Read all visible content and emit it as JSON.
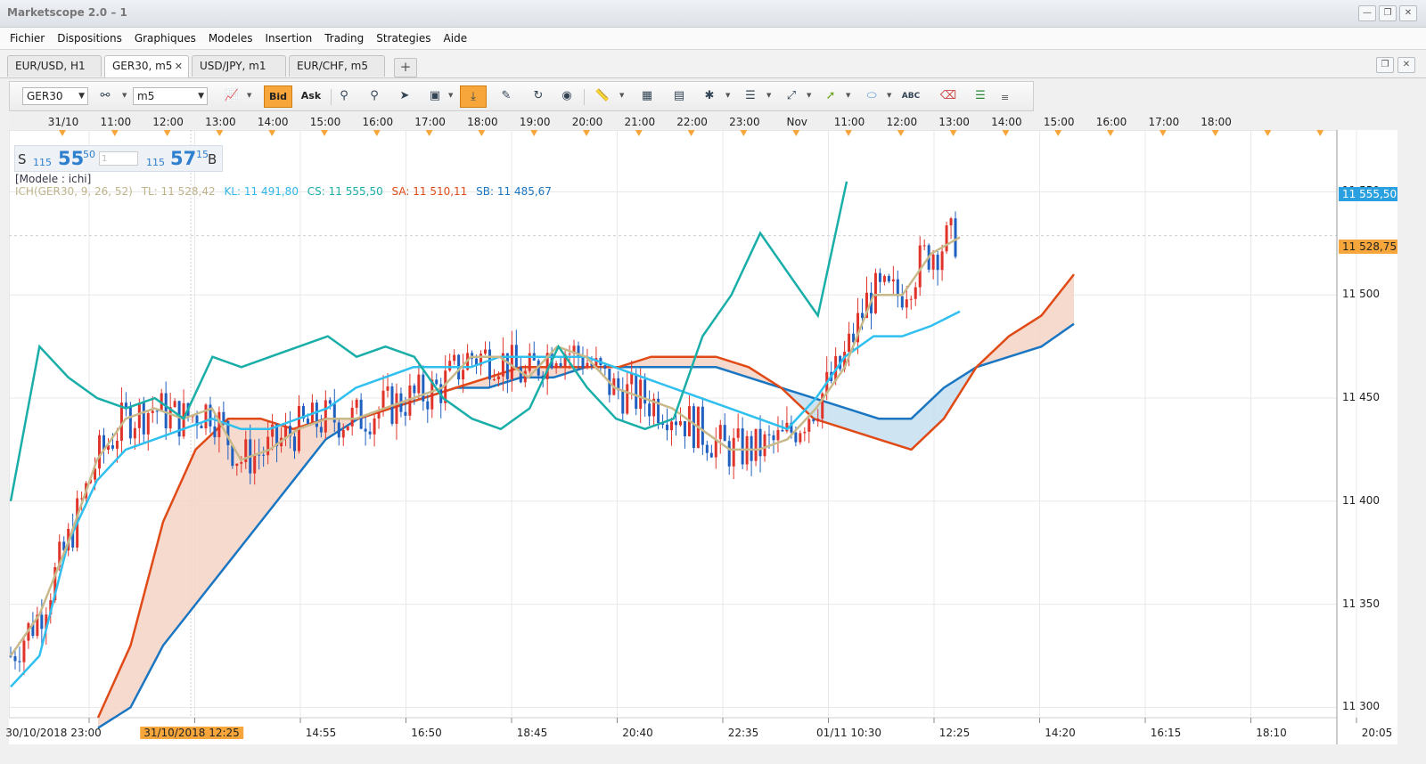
{
  "window": {
    "title": "Marketscope 2.0 – 1"
  },
  "menu": [
    "Fichier",
    "Dispositions",
    "Graphiques",
    "Modeles",
    "Insertion",
    "Trading",
    "Strategies",
    "Aide"
  ],
  "tabs": [
    {
      "label": "EUR/USD, H1"
    },
    {
      "label": "GER30, m5",
      "close": "✕"
    },
    {
      "label": "USD/JPY, m1"
    },
    {
      "label": "EUR/CHF, m5"
    }
  ],
  "toolbar": {
    "instrument": "GER30",
    "timeframe": "m5",
    "bid_label": "Bid",
    "ask_label": "Ask"
  },
  "top_time_labels": [
    "31/10",
    "11:00",
    "12:00",
    "13:00",
    "14:00",
    "15:00",
    "16:00",
    "17:00",
    "18:00",
    "19:00",
    "20:00",
    "21:00",
    "22:00",
    "23:00",
    "Nov",
    "11:00",
    "12:00",
    "13:00",
    "14:00",
    "15:00",
    "16:00",
    "17:00",
    "18:00"
  ],
  "bottom_time_labels": [
    "30/10/2018 23:00",
    "31/10/2018 12:25",
    "14:55",
    "16:50",
    "18:45",
    "20:40",
    "22:35",
    "01/11 10:30",
    "12:25",
    "14:20",
    "16:15",
    "18:10",
    "20:05"
  ],
  "price_axis": [
    "11 550",
    "11 500",
    "11 450",
    "11 400",
    "11 350",
    "11 300"
  ],
  "price_tags": {
    "cs": "11 555,50",
    "tl": "11 528,75"
  },
  "quote": {
    "sell_label": "S",
    "sell_prefix": "115",
    "sell_big": "55",
    "sell_sup": "50",
    "amount": "1",
    "buy_prefix": "115",
    "buy_big": "57",
    "buy_sup": "15",
    "buy_label": "B"
  },
  "model_label": "[Modele : ichi]",
  "indicator": {
    "name": "ICH(GER30, 9, 26, 52)",
    "tl": "TL: 11 528,42",
    "kl": "KL: 11 491,80",
    "cs": "CS: 11 555,50",
    "sa": "SA: 11 510,11",
    "sb": "SB: 11 485,67"
  },
  "colors": {
    "up": "#e0342a",
    "down": "#1f5fbf",
    "tenkan": "#c8b98a",
    "kijun": "#2fc0ef",
    "chikou": "#1aaea8",
    "senkou_a": "#e04a17",
    "senkou_b": "#1b76c2",
    "cloud_bull": "#c5dff0",
    "cloud_bear": "#f6d3c6",
    "accent": "#f7a63c"
  },
  "chart_data": {
    "type": "line",
    "title": "",
    "instrument": "GER30",
    "timeframe": "m5",
    "ylim": [
      11295,
      11580
    ],
    "y_ticks": [
      11300,
      11350,
      11400,
      11450,
      11500,
      11550
    ],
    "series": [
      {
        "name": "TL",
        "values": [
          11325,
          11345,
          11380,
          11420,
          11440,
          11445,
          11440,
          11445,
          11420,
          11425,
          11435,
          11440,
          11440,
          11445,
          11450,
          11455,
          11470,
          11470,
          11460,
          11475,
          11470,
          11455,
          11450,
          11445,
          11435,
          11425,
          11425,
          11430,
          11445,
          11465,
          11500,
          11500,
          11520,
          11528
        ]
      },
      {
        "name": "KL",
        "values": [
          11310,
          11325,
          11380,
          11410,
          11425,
          11430,
          11435,
          11440,
          11435,
          11435,
          11440,
          11445,
          11455,
          11460,
          11465,
          11465,
          11465,
          11470,
          11470,
          11470,
          11470,
          11465,
          11460,
          11455,
          11450,
          11445,
          11440,
          11435,
          11450,
          11470,
          11480,
          11480,
          11485,
          11492
        ]
      },
      {
        "name": "CS",
        "values": [
          11400,
          11475,
          11460,
          11450,
          11445,
          11450,
          11440,
          11470,
          11465,
          11470,
          11475,
          11480,
          11470,
          11475,
          11470,
          11450,
          11440,
          11435,
          11445,
          11475,
          11455,
          11440,
          11435,
          11440,
          11480,
          11500,
          11530,
          11510,
          11490,
          11555
        ]
      },
      {
        "name": "SA",
        "values": [
          11295,
          11330,
          11390,
          11425,
          11440,
          11440,
          11435,
          11440,
          11440,
          11445,
          11450,
          11455,
          11460,
          11465,
          11465,
          11465,
          11465,
          11470,
          11470,
          11470,
          11465,
          11455,
          11440,
          11435,
          11430,
          11425,
          11440,
          11465,
          11480,
          11490,
          11510
        ]
      },
      {
        "name": "SB",
        "values": [
          11290,
          11300,
          11330,
          11350,
          11370,
          11390,
          11410,
          11430,
          11440,
          11445,
          11450,
          11455,
          11455,
          11460,
          11460,
          11465,
          11465,
          11465,
          11465,
          11465,
          11460,
          11455,
          11450,
          11445,
          11440,
          11440,
          11455,
          11465,
          11470,
          11475,
          11486
        ]
      }
    ]
  }
}
